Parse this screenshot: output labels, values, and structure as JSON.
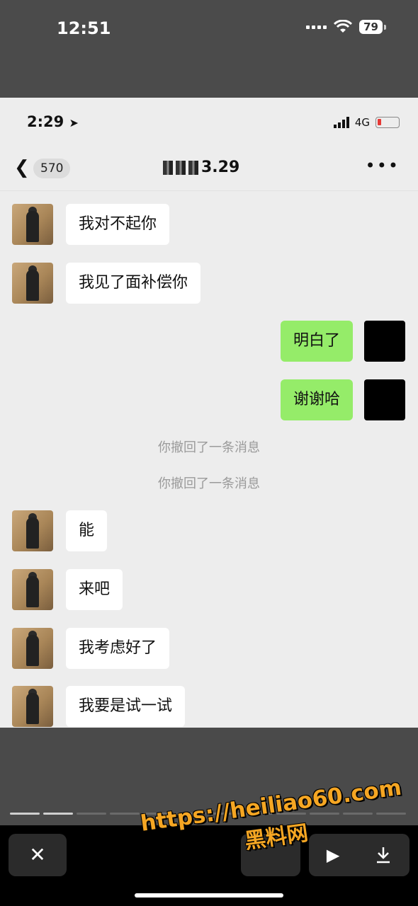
{
  "outer_status": {
    "time": "12:51",
    "battery": "79"
  },
  "inner_status": {
    "time": "2:29",
    "network": "4G"
  },
  "chat": {
    "unread_count": "570",
    "title_suffix": "3.29",
    "messages": [
      {
        "side": "left",
        "text": "我对不起你"
      },
      {
        "side": "left",
        "text": "我见了面补偿你"
      },
      {
        "side": "right",
        "text": "明白了"
      },
      {
        "side": "right",
        "text": "谢谢哈"
      },
      {
        "side": "system",
        "text": "你撤回了一条消息"
      },
      {
        "side": "system",
        "text": "你撤回了一条消息"
      },
      {
        "side": "left",
        "text": "能"
      },
      {
        "side": "left",
        "text": "来吧"
      },
      {
        "side": "left",
        "text": "我考虑好了"
      },
      {
        "side": "left",
        "text": "我要是试一试"
      }
    ]
  },
  "icons": {
    "back": "chevron-left-icon",
    "more": "more-icon",
    "close": "close-icon",
    "play": "play-icon",
    "download": "download-icon"
  },
  "watermark": {
    "url": "https://heiliao60.com",
    "site": "黑料网"
  },
  "colors": {
    "sent_bubble": "#95ec69",
    "received_bubble": "#ffffff",
    "chat_bg": "#ededed"
  }
}
